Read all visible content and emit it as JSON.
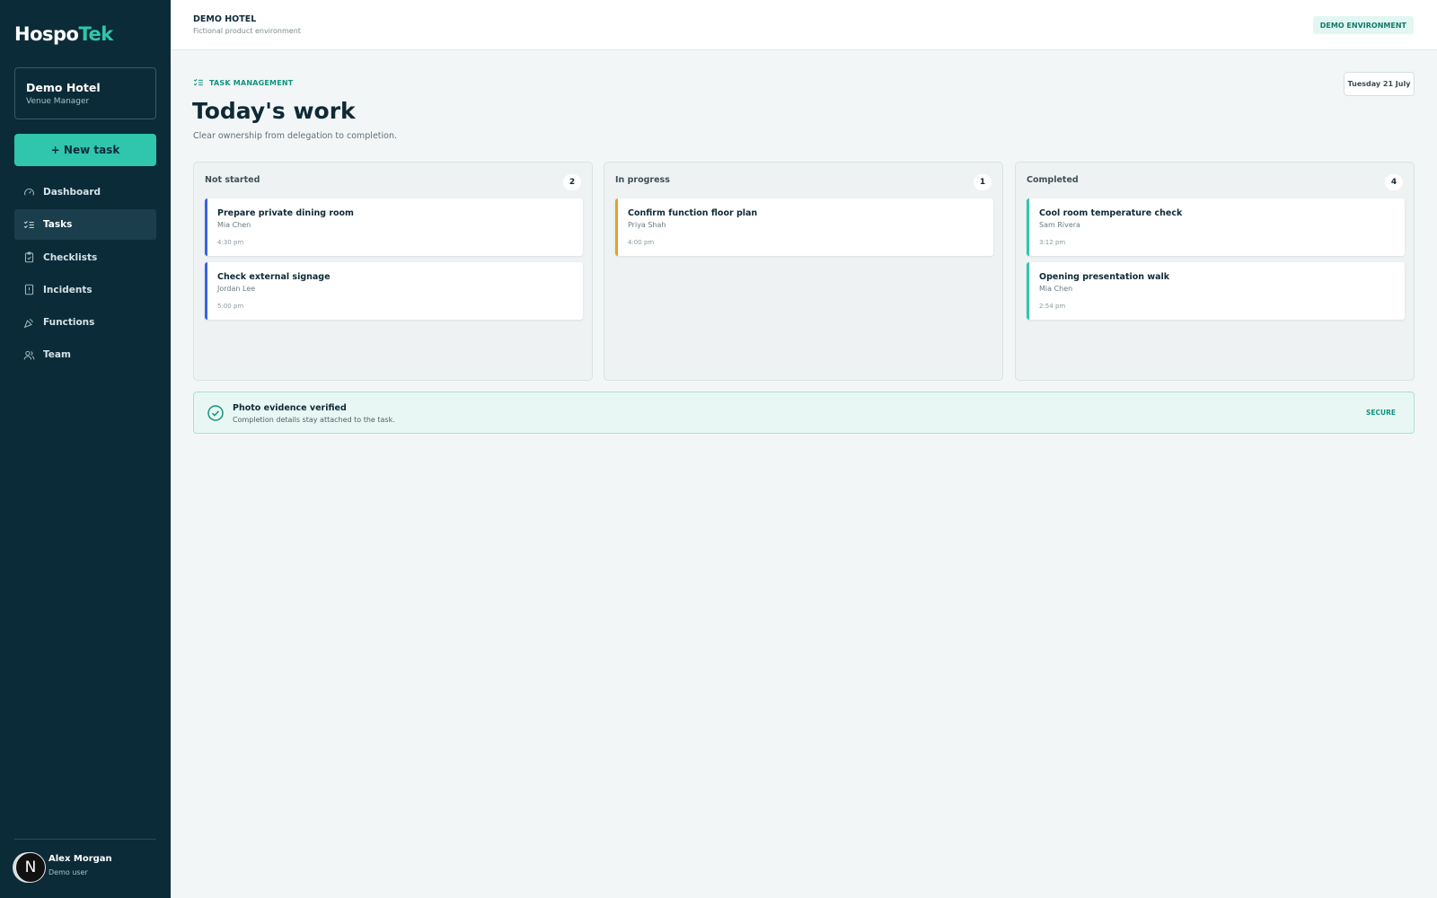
{
  "app": {
    "logo_part1": "Hospo",
    "logo_part2": "Tek"
  },
  "venue": {
    "name": "Demo Hotel",
    "role": "Venue Manager"
  },
  "actions": {
    "new_task": "+ New task"
  },
  "nav": {
    "items": [
      {
        "label": "Dashboard",
        "icon": "gauge-icon"
      },
      {
        "label": "Tasks",
        "icon": "checklist-icon",
        "active": true
      },
      {
        "label": "Checklists",
        "icon": "clipboard-check-icon"
      },
      {
        "label": "Incidents",
        "icon": "alert-file-icon"
      },
      {
        "label": "Functions",
        "icon": "party-popper-icon"
      },
      {
        "label": "Team",
        "icon": "users-icon"
      }
    ]
  },
  "user": {
    "avatar_letter": "N",
    "name": "Alex Morgan",
    "role": "Demo user"
  },
  "topbar": {
    "title": "DEMO HOTEL",
    "subtitle": "Fictional product environment",
    "badge": "DEMO ENVIRONMENT"
  },
  "header": {
    "section": "TASK MANAGEMENT",
    "title": "Today's work",
    "subtitle": "Clear ownership from delegation to completion.",
    "date": "Tuesday 21 July"
  },
  "colors": {
    "not_started": "#3a63e0",
    "in_progress": "#e9a11f",
    "completed": "#2fc6ad"
  },
  "board": {
    "columns": [
      {
        "title": "Not started",
        "count": "2",
        "tasks": [
          {
            "title": "Prepare private dining room",
            "person": "Mia Chen",
            "time": "4:30 pm"
          },
          {
            "title": "Check external signage",
            "person": "Jordan Lee",
            "time": "5:00 pm"
          }
        ]
      },
      {
        "title": "In progress",
        "count": "1",
        "tasks": [
          {
            "title": "Confirm function floor plan",
            "person": "Priya Shah",
            "time": "4:00 pm"
          }
        ]
      },
      {
        "title": "Completed",
        "count": "4",
        "tasks": [
          {
            "title": "Cool room temperature check",
            "person": "Sam Rivera",
            "time": "3:12 pm"
          },
          {
            "title": "Opening presentation walk",
            "person": "Mia Chen",
            "time": "2:54 pm"
          }
        ]
      }
    ]
  },
  "evidence": {
    "title": "Photo evidence verified",
    "subtitle": "Completion details stay attached to the task.",
    "badge": "SECURE"
  }
}
